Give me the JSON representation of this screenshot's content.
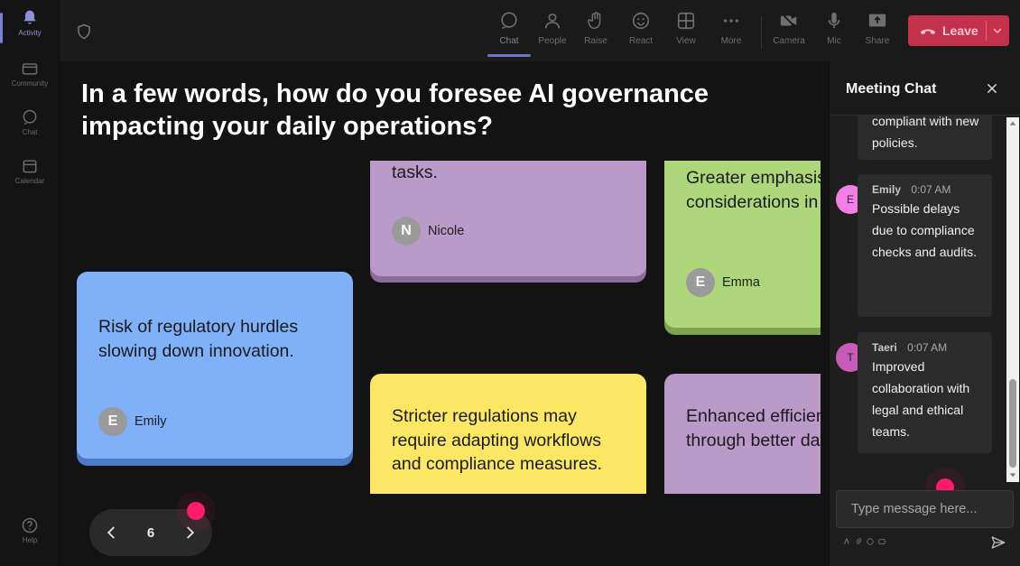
{
  "rail": {
    "items": [
      {
        "label": "Activity",
        "icon": "bell-icon"
      },
      {
        "label": "Community",
        "icon": "community-icon"
      },
      {
        "label": "Chat",
        "icon": "chat-icon"
      },
      {
        "label": "Calendar",
        "icon": "calendar-icon"
      },
      {
        "label": "Help",
        "icon": "help-icon"
      }
    ]
  },
  "toolbar": {
    "chat": "Chat",
    "people": "People",
    "raise": "Raise",
    "react": "React",
    "view": "View",
    "more": "More",
    "camera": "Camera",
    "mic": "Mic",
    "share": "Share",
    "leave": "Leave"
  },
  "stage": {
    "question": "In a few words, how do you foresee AI governance impacting your daily operations?",
    "cards": [
      {
        "text": "tasks.",
        "author": "Nicole",
        "initial": "N",
        "color": "#b99ac8"
      },
      {
        "text": "Greater emphasis on ethical considerations in strategic planning.",
        "author": "Emma",
        "initial": "E",
        "color": "#aed67a"
      },
      {
        "text": "Risk of regulatory hurdles slowing down innovation.",
        "author": "Emily",
        "initial": "E",
        "color": "#7fb0f8"
      },
      {
        "text": "Stricter regulations may require adapting workflows and compliance measures.",
        "color": "#fce764"
      },
      {
        "text": "Enhanced efficiency in decision-making through better data management.",
        "color": "#b99ac8"
      }
    ],
    "pager": {
      "page": "6"
    }
  },
  "chat": {
    "title": "Meeting Chat",
    "messages": [
      {
        "text": "compliant with new policies."
      },
      {
        "name": "Emily",
        "time": "0:07 AM",
        "initial": "E",
        "avatar_color": "#f27fe6",
        "text": "Possible delays due to compliance checks and audits."
      },
      {
        "name": "Taeri",
        "time": "0:07 AM",
        "initial": "T",
        "avatar_color": "#c85ab8",
        "text": "Improved collaboration with legal and ethical teams."
      }
    ],
    "compose_placeholder": "Type message here..."
  }
}
